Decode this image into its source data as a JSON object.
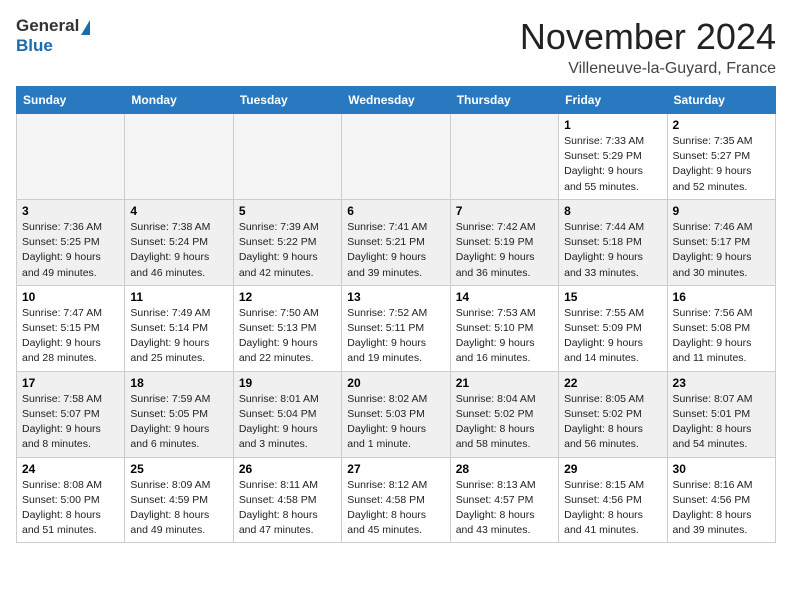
{
  "header": {
    "logo_general": "General",
    "logo_blue": "Blue",
    "month_title": "November 2024",
    "location": "Villeneuve-la-Guyard, France"
  },
  "weekdays": [
    "Sunday",
    "Monday",
    "Tuesday",
    "Wednesday",
    "Thursday",
    "Friday",
    "Saturday"
  ],
  "weeks": [
    [
      {
        "day": "",
        "info": ""
      },
      {
        "day": "",
        "info": ""
      },
      {
        "day": "",
        "info": ""
      },
      {
        "day": "",
        "info": ""
      },
      {
        "day": "",
        "info": ""
      },
      {
        "day": "1",
        "info": "Sunrise: 7:33 AM\nSunset: 5:29 PM\nDaylight: 9 hours\nand 55 minutes."
      },
      {
        "day": "2",
        "info": "Sunrise: 7:35 AM\nSunset: 5:27 PM\nDaylight: 9 hours\nand 52 minutes."
      }
    ],
    [
      {
        "day": "3",
        "info": "Sunrise: 7:36 AM\nSunset: 5:25 PM\nDaylight: 9 hours\nand 49 minutes."
      },
      {
        "day": "4",
        "info": "Sunrise: 7:38 AM\nSunset: 5:24 PM\nDaylight: 9 hours\nand 46 minutes."
      },
      {
        "day": "5",
        "info": "Sunrise: 7:39 AM\nSunset: 5:22 PM\nDaylight: 9 hours\nand 42 minutes."
      },
      {
        "day": "6",
        "info": "Sunrise: 7:41 AM\nSunset: 5:21 PM\nDaylight: 9 hours\nand 39 minutes."
      },
      {
        "day": "7",
        "info": "Sunrise: 7:42 AM\nSunset: 5:19 PM\nDaylight: 9 hours\nand 36 minutes."
      },
      {
        "day": "8",
        "info": "Sunrise: 7:44 AM\nSunset: 5:18 PM\nDaylight: 9 hours\nand 33 minutes."
      },
      {
        "day": "9",
        "info": "Sunrise: 7:46 AM\nSunset: 5:17 PM\nDaylight: 9 hours\nand 30 minutes."
      }
    ],
    [
      {
        "day": "10",
        "info": "Sunrise: 7:47 AM\nSunset: 5:15 PM\nDaylight: 9 hours\nand 28 minutes."
      },
      {
        "day": "11",
        "info": "Sunrise: 7:49 AM\nSunset: 5:14 PM\nDaylight: 9 hours\nand 25 minutes."
      },
      {
        "day": "12",
        "info": "Sunrise: 7:50 AM\nSunset: 5:13 PM\nDaylight: 9 hours\nand 22 minutes."
      },
      {
        "day": "13",
        "info": "Sunrise: 7:52 AM\nSunset: 5:11 PM\nDaylight: 9 hours\nand 19 minutes."
      },
      {
        "day": "14",
        "info": "Sunrise: 7:53 AM\nSunset: 5:10 PM\nDaylight: 9 hours\nand 16 minutes."
      },
      {
        "day": "15",
        "info": "Sunrise: 7:55 AM\nSunset: 5:09 PM\nDaylight: 9 hours\nand 14 minutes."
      },
      {
        "day": "16",
        "info": "Sunrise: 7:56 AM\nSunset: 5:08 PM\nDaylight: 9 hours\nand 11 minutes."
      }
    ],
    [
      {
        "day": "17",
        "info": "Sunrise: 7:58 AM\nSunset: 5:07 PM\nDaylight: 9 hours\nand 8 minutes."
      },
      {
        "day": "18",
        "info": "Sunrise: 7:59 AM\nSunset: 5:05 PM\nDaylight: 9 hours\nand 6 minutes."
      },
      {
        "day": "19",
        "info": "Sunrise: 8:01 AM\nSunset: 5:04 PM\nDaylight: 9 hours\nand 3 minutes."
      },
      {
        "day": "20",
        "info": "Sunrise: 8:02 AM\nSunset: 5:03 PM\nDaylight: 9 hours\nand 1 minute."
      },
      {
        "day": "21",
        "info": "Sunrise: 8:04 AM\nSunset: 5:02 PM\nDaylight: 8 hours\nand 58 minutes."
      },
      {
        "day": "22",
        "info": "Sunrise: 8:05 AM\nSunset: 5:02 PM\nDaylight: 8 hours\nand 56 minutes."
      },
      {
        "day": "23",
        "info": "Sunrise: 8:07 AM\nSunset: 5:01 PM\nDaylight: 8 hours\nand 54 minutes."
      }
    ],
    [
      {
        "day": "24",
        "info": "Sunrise: 8:08 AM\nSunset: 5:00 PM\nDaylight: 8 hours\nand 51 minutes."
      },
      {
        "day": "25",
        "info": "Sunrise: 8:09 AM\nSunset: 4:59 PM\nDaylight: 8 hours\nand 49 minutes."
      },
      {
        "day": "26",
        "info": "Sunrise: 8:11 AM\nSunset: 4:58 PM\nDaylight: 8 hours\nand 47 minutes."
      },
      {
        "day": "27",
        "info": "Sunrise: 8:12 AM\nSunset: 4:58 PM\nDaylight: 8 hours\nand 45 minutes."
      },
      {
        "day": "28",
        "info": "Sunrise: 8:13 AM\nSunset: 4:57 PM\nDaylight: 8 hours\nand 43 minutes."
      },
      {
        "day": "29",
        "info": "Sunrise: 8:15 AM\nSunset: 4:56 PM\nDaylight: 8 hours\nand 41 minutes."
      },
      {
        "day": "30",
        "info": "Sunrise: 8:16 AM\nSunset: 4:56 PM\nDaylight: 8 hours\nand 39 minutes."
      }
    ]
  ]
}
